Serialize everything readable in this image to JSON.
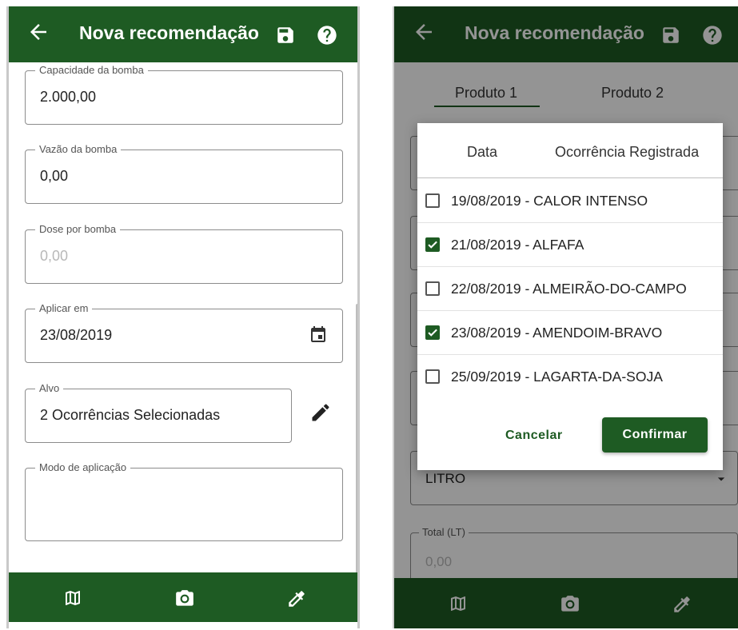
{
  "app": {
    "title": "Nova recomendação"
  },
  "colors": {
    "primary": "#1e5b23",
    "on_primary": "#ffffff"
  },
  "icons": {
    "back": "arrow-back-icon",
    "save": "save-icon",
    "help": "help-icon",
    "map": "map-icon",
    "camera": "camera-icon",
    "picker": "color-picker-icon",
    "calendar": "calendar-icon",
    "edit": "edit-pencil-icon",
    "dropdown": "dropdown-arrow-icon"
  },
  "left_form": {
    "fields": [
      {
        "label": "Capacidade da bomba",
        "value": "2.000,00",
        "placeholder": ""
      },
      {
        "label": "Vazão da bomba",
        "value": "0,00",
        "placeholder": ""
      },
      {
        "label": "Dose por bomba",
        "value": "",
        "placeholder": "0,00"
      },
      {
        "label": "Aplicar em",
        "value": "23/08/2019",
        "placeholder": ""
      },
      {
        "label": "Alvo",
        "value": "2 Ocorrências Selecionadas",
        "placeholder": ""
      },
      {
        "label": "Modo de aplicação",
        "value": "",
        "placeholder": ""
      }
    ]
  },
  "right_screen": {
    "tabs": [
      {
        "label": "Produto 1",
        "selected": true
      },
      {
        "label": "Produto 2",
        "selected": false
      }
    ],
    "unit_select": {
      "value": "LITRO"
    },
    "total_field": {
      "label": "Total (LT)",
      "placeholder": "0,00"
    },
    "dialog": {
      "headers": [
        "Data",
        "Ocorrência Registrada"
      ],
      "items": [
        {
          "text": "19/08/2019 - CALOR INTENSO",
          "checked": false
        },
        {
          "text": "21/08/2019 - ALFAFA",
          "checked": true
        },
        {
          "text": "22/08/2019 - ALMEIRÃO-DO-CAMPO",
          "checked": false
        },
        {
          "text": "23/08/2019 - AMENDOIM-BRAVO",
          "checked": true
        },
        {
          "text": "25/09/2019 - LAGARTA-DA-SOJA",
          "checked": false
        }
      ],
      "cancel_label": "Cancelar",
      "confirm_label": "Confirmar"
    }
  }
}
